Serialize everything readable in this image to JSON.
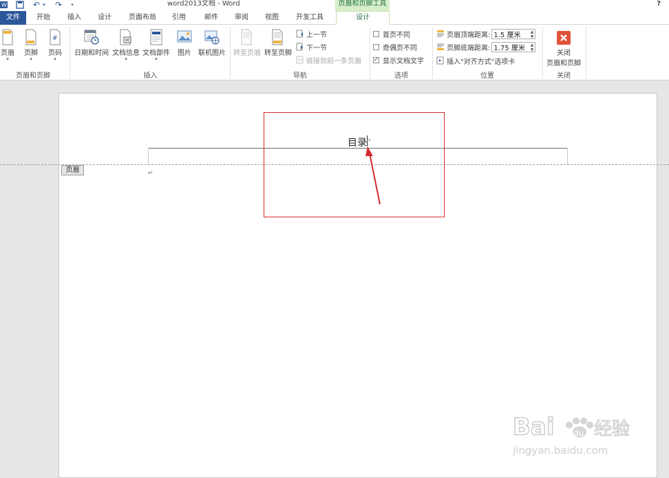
{
  "title_bar": {
    "document_title": "word2013文档 - Word",
    "context_group": "页眉和页脚工具",
    "help": "?"
  },
  "tabs": [
    "文件",
    "开始",
    "插入",
    "设计",
    "页面布局",
    "引用",
    "邮件",
    "审阅",
    "视图",
    "开发工具",
    "设计"
  ],
  "ribbon": {
    "group_header_footer": {
      "label": "页眉和页脚",
      "buttons": [
        "页眉",
        "页脚",
        "页码"
      ]
    },
    "group_insert": {
      "label": "插入",
      "buttons": [
        "日期和时间",
        "文档信息",
        "文档部件",
        "图片",
        "联机图片"
      ]
    },
    "group_navigation": {
      "label": "导航",
      "buttons": [
        "转至页眉",
        "转至页脚"
      ],
      "small": [
        "上一节",
        "下一节",
        "链接到前一条页眉"
      ]
    },
    "group_options": {
      "label": "选项",
      "checkboxes": [
        {
          "label": "首页不同",
          "checked": false
        },
        {
          "label": "奇偶页不同",
          "checked": false
        },
        {
          "label": "显示文档文字",
          "checked": true
        }
      ]
    },
    "group_position": {
      "label": "位置",
      "header_distance_label": "页眉顶端距离:",
      "header_distance_value": "1.5 厘米",
      "footer_distance_label": "页脚底端距离:",
      "footer_distance_value": "1.75 厘米",
      "insert_align_tab": "插入\"对齐方式\"选项卡"
    },
    "group_close": {
      "label": "关闭",
      "button_line1": "关闭",
      "button_line2": "页眉和页脚"
    }
  },
  "document": {
    "header_text": "目录",
    "header_tag": "页眉",
    "paragraph_mark": "↵"
  },
  "colors": {
    "accent": "#2b579a",
    "context_green": "#217346",
    "context_bg": "#d8eec9",
    "annotation_red": "#d42a2a",
    "close_red": "#e0533a"
  }
}
